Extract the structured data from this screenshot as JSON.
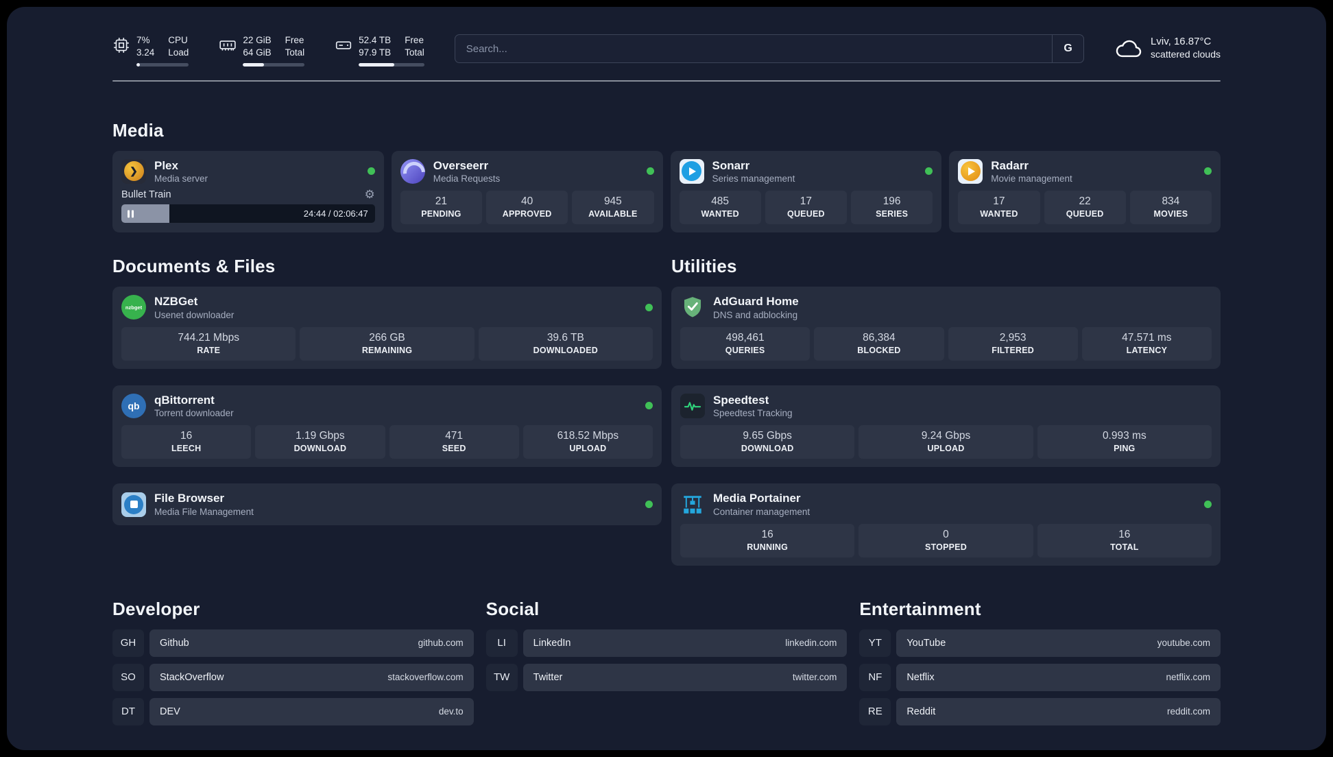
{
  "topbar": {
    "cpu": {
      "icon": "cpu-icon",
      "percent": "7%",
      "load": "3.24",
      "label1": "CPU",
      "label2": "Load",
      "progress": 7
    },
    "memory": {
      "icon": "memory-icon",
      "free": "22 GiB",
      "total": "64 GiB",
      "label1": "Free",
      "label2": "Total",
      "progress": 34
    },
    "disk": {
      "icon": "disk-icon",
      "free": "52.4 TB",
      "total": "97.9 TB",
      "label1": "Free",
      "label2": "Total",
      "progress": 54
    },
    "search": {
      "placeholder": "Search...",
      "engine_label": "G"
    },
    "weather": {
      "icon": "cloud-icon",
      "location": "Lviv, 16.87°C",
      "condition": "scattered clouds"
    }
  },
  "sections": {
    "media": {
      "title": "Media",
      "apps": [
        {
          "name": "Plex",
          "subtitle": "Media server",
          "icon": "plex-icon",
          "online": true,
          "player": {
            "track": "Bullet Train",
            "time": "24:44 / 02:06:47",
            "progress": 19
          }
        },
        {
          "name": "Overseerr",
          "subtitle": "Media Requests",
          "icon": "overseerr-icon",
          "online": true,
          "stats": [
            {
              "value": "21",
              "label": "PENDING"
            },
            {
              "value": "40",
              "label": "APPROVED"
            },
            {
              "value": "945",
              "label": "AVAILABLE"
            }
          ]
        },
        {
          "name": "Sonarr",
          "subtitle": "Series management",
          "icon": "sonarr-icon",
          "online": true,
          "stats": [
            {
              "value": "485",
              "label": "WANTED"
            },
            {
              "value": "17",
              "label": "QUEUED"
            },
            {
              "value": "196",
              "label": "SERIES"
            }
          ]
        },
        {
          "name": "Radarr",
          "subtitle": "Movie management",
          "icon": "radarr-icon",
          "online": true,
          "stats": [
            {
              "value": "17",
              "label": "WANTED"
            },
            {
              "value": "22",
              "label": "QUEUED"
            },
            {
              "value": "834",
              "label": "MOVIES"
            }
          ]
        }
      ]
    },
    "documents": {
      "title": "Documents & Files",
      "apps": [
        {
          "name": "NZBGet",
          "subtitle": "Usenet downloader",
          "icon": "nzbget-icon",
          "icon_label": "nzbget",
          "online": true,
          "stats": [
            {
              "value": "744.21 Mbps",
              "label": "RATE"
            },
            {
              "value": "266 GB",
              "label": "REMAINING"
            },
            {
              "value": "39.6 TB",
              "label": "DOWNLOADED"
            }
          ]
        },
        {
          "name": "qBittorrent",
          "subtitle": "Torrent downloader",
          "icon": "qbittorrent-icon",
          "icon_label": "qb",
          "online": true,
          "stats": [
            {
              "value": "16",
              "label": "LEECH"
            },
            {
              "value": "1.19 Gbps",
              "label": "DOWNLOAD"
            },
            {
              "value": "471",
              "label": "SEED"
            },
            {
              "value": "618.52 Mbps",
              "label": "UPLOAD"
            }
          ]
        },
        {
          "name": "File Browser",
          "subtitle": "Media File Management",
          "icon": "filebrowser-icon",
          "online": true,
          "stats": []
        }
      ]
    },
    "utilities": {
      "title": "Utilities",
      "apps": [
        {
          "name": "AdGuard Home",
          "subtitle": "DNS and adblocking",
          "icon": "adguard-shield-icon",
          "online": false,
          "stats": [
            {
              "value": "498,461",
              "label": "QUERIES"
            },
            {
              "value": "86,384",
              "label": "BLOCKED"
            },
            {
              "value": "2,953",
              "label": "FILTERED"
            },
            {
              "value": "47.571 ms",
              "label": "LATENCY"
            }
          ]
        },
        {
          "name": "Speedtest",
          "subtitle": "Speedtest Tracking",
          "icon": "speedtest-graph-icon",
          "online": false,
          "stats": [
            {
              "value": "9.65 Gbps",
              "label": "DOWNLOAD"
            },
            {
              "value": "9.24 Gbps",
              "label": "UPLOAD"
            },
            {
              "value": "0.993 ms",
              "label": "PING"
            }
          ]
        },
        {
          "name": "Media Portainer",
          "subtitle": "Container management",
          "icon": "portainer-crane-icon",
          "online": true,
          "stats": [
            {
              "value": "16",
              "label": "RUNNING"
            },
            {
              "value": "0",
              "label": "STOPPED"
            },
            {
              "value": "16",
              "label": "TOTAL"
            }
          ]
        }
      ]
    },
    "developer": {
      "title": "Developer",
      "bookmarks": [
        {
          "abbr": "GH",
          "name": "Github",
          "url": "github.com"
        },
        {
          "abbr": "SO",
          "name": "StackOverflow",
          "url": "stackoverflow.com"
        },
        {
          "abbr": "DT",
          "name": "DEV",
          "url": "dev.to"
        }
      ]
    },
    "social": {
      "title": "Social",
      "bookmarks": [
        {
          "abbr": "LI",
          "name": "LinkedIn",
          "url": "linkedin.com"
        },
        {
          "abbr": "TW",
          "name": "Twitter",
          "url": "twitter.com"
        }
      ]
    },
    "entertainment": {
      "title": "Entertainment",
      "bookmarks": [
        {
          "abbr": "YT",
          "name": "YouTube",
          "url": "youtube.com"
        },
        {
          "abbr": "NF",
          "name": "Netflix",
          "url": "netflix.com"
        },
        {
          "abbr": "RE",
          "name": "Reddit",
          "url": "reddit.com"
        }
      ]
    }
  }
}
